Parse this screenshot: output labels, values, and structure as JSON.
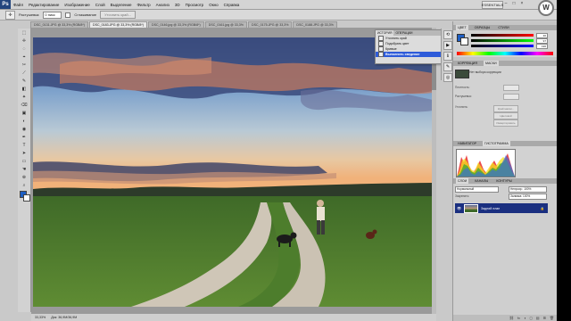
{
  "app": {
    "logo_text": "Ps",
    "workspace": "ESSENTIALS",
    "window_controls": [
      "–",
      "□",
      "×"
    ],
    "watermark": "W"
  },
  "menu": [
    "Файл",
    "Редактирование",
    "Изображение",
    "Слой",
    "Выделение",
    "Фильтр",
    "Анализ",
    "3D",
    "Просмотр",
    "Окно",
    "Справка"
  ],
  "options_bar": {
    "tool_glyph": "✛",
    "mode_label": "Растушевка:",
    "mode_value": "0 пикс",
    "antialias_label": "Сглаживание",
    "refine_button": "Уточнить край..."
  },
  "doc_tabs": [
    {
      "label": "DSC_0131.JPG @ 33,3% (RGB/8*)",
      "active": false
    },
    {
      "label": "DSC_0183.JPG @ 33,3% (RGB/8*)",
      "active": true
    },
    {
      "label": "DSC_0146.jpg @ 33,3% (RGB/8*)",
      "active": false
    },
    {
      "label": "DSC_0161.jpg @ 33,3%",
      "active": false
    },
    {
      "label": "DSC_0175.JPG @ 33,3%",
      "active": false
    },
    {
      "label": "DSC_0188.JPG @ 33,3%",
      "active": false
    }
  ],
  "tools": [
    "⬚",
    "✛",
    "◌",
    "⌖",
    "✂",
    "⟋",
    "✎",
    "◧",
    "✦",
    "⌫",
    "▣",
    "◐",
    "◉",
    "✒",
    "T",
    "➤",
    "▭",
    "☚",
    "⊕",
    "⌕"
  ],
  "history_panel": {
    "tabs": [
      "ИСТОРИЯ",
      "ОПЕРАЦИИ"
    ],
    "rows": [
      {
        "label": "Уточнить край",
        "selected": false
      },
      {
        "label": "Подобрать цвет",
        "selected": false
      },
      {
        "label": "Кривые",
        "selected": false
      },
      {
        "label": "Выполнить сведение",
        "selected": true
      }
    ]
  },
  "color_panel": {
    "tabs": [
      "ЦВЕТ",
      "ОБРАЗЦЫ",
      "СТИЛИ"
    ],
    "values": [
      "30",
      "97",
      "196"
    ],
    "fg_color": "#1e5fc4"
  },
  "adjustments_panel": {
    "tabs": [
      "КОРРЕКЦИЯ",
      "МАСКИ"
    ],
    "title": "Нет выбора коррекции",
    "labels": [
      "Плотность:",
      "Растушевка:",
      "Уточнить:"
    ],
    "buttons": [
      "Край маски...",
      "Цветовой диапазон...",
      "Инвертировать"
    ]
  },
  "histogram_panel": {
    "tabs": [
      "НАВИГАТОР",
      "ГИСТОГРАММА"
    ]
  },
  "layers_panel": {
    "tabs": [
      "СЛОИ",
      "КАНАЛЫ",
      "КОНТУРЫ"
    ],
    "blend_mode": "Нормальный",
    "opacity_label": "Непрозр.: 100%",
    "fill_label": "Заливка: 100%",
    "lock_label": "Закрепить:",
    "layer_name": "Задний план",
    "bottom_icons": [
      "⛓",
      "fx",
      "◑",
      "◻",
      "▤",
      "⊞",
      "🗑"
    ]
  },
  "status": {
    "zoom": "33,33%",
    "doc_info": "Док: 36,9М/36,9М"
  }
}
